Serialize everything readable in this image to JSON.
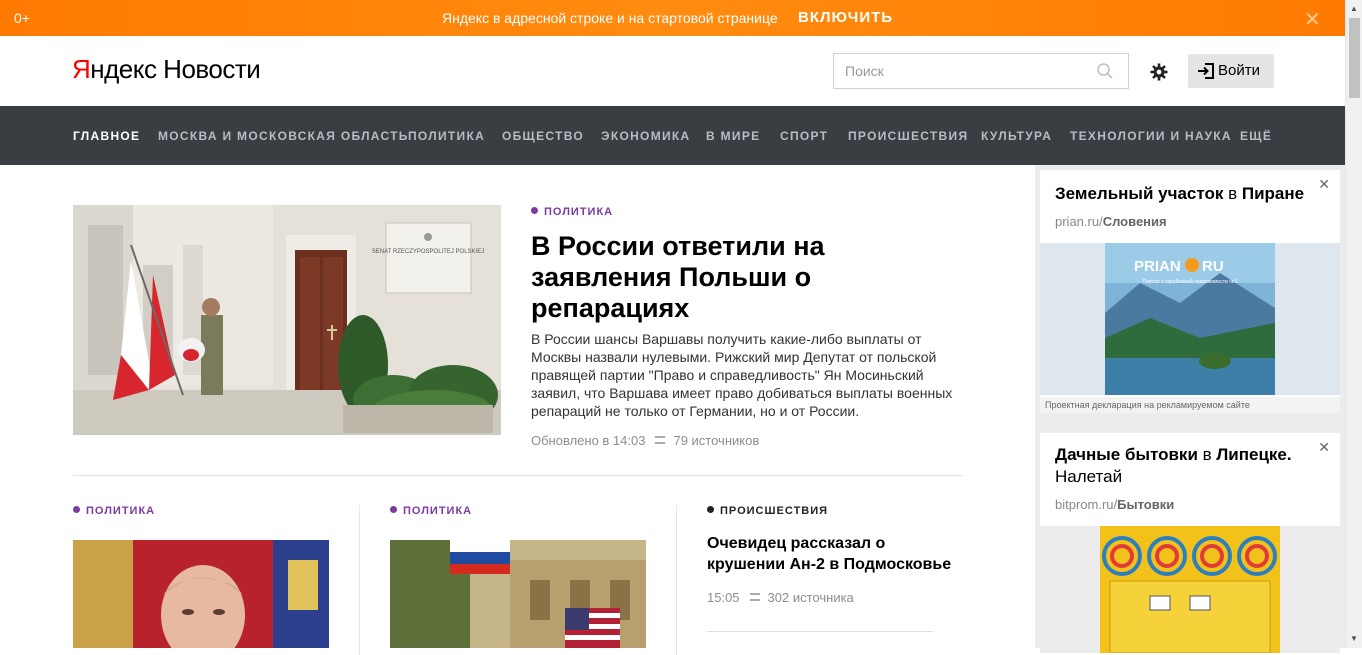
{
  "promo": {
    "age": "0+",
    "message": "Яндекс в адресной строке и на стартовой странице",
    "cta": "ВКЛЮЧИТЬ",
    "close": "✕"
  },
  "header": {
    "logo_brand_first": "Я",
    "logo_brand_rest": "ндекс",
    "logo_service": "Новости",
    "search_placeholder": "Поиск",
    "login_label": "Войти"
  },
  "nav": {
    "items": [
      {
        "label": "ГЛАВНОЕ",
        "active": true
      },
      {
        "label": "МОСКВА И МОСКОВСКАЯ ОБЛАСТЬ"
      },
      {
        "label": "ПОЛИТИКА"
      },
      {
        "label": "ОБЩЕСТВО"
      },
      {
        "label": "ЭКОНОМИКА"
      },
      {
        "label": "В МИРЕ"
      },
      {
        "label": "СПОРТ"
      },
      {
        "label": "ПРОИСШЕСТВИЯ"
      },
      {
        "label": "КУЛЬТУРА"
      },
      {
        "label": "ТЕХНОЛОГИИ И НАУКА"
      },
      {
        "label": "ЕЩЁ"
      }
    ]
  },
  "lead": {
    "rubric": "ПОЛИТИКА",
    "title": "В России ответили на заявления Польши о репарациях",
    "text": "В России шансы Варшавы получить какие-либо выплаты от Москвы назвали нулевыми. Рижский мир Депутат от польской правящей партии \"Право и справедливость\" Ян Мосиньский заявил, что Варшава имеет право добиваться выплаты военных репараций не только от Германии, но и от России.",
    "updated": "Обновлено в 14:03",
    "sources": "79 источников",
    "plaque": "SENAT RZECZYPOSPOLITEJ POLSKIEJ"
  },
  "cards": [
    {
      "rubric": "ПОЛИТИКА"
    },
    {
      "rubric": "ПОЛИТИКА"
    },
    {
      "rubric": "ПРОИСШЕСТВИЯ",
      "title": "Очевидец рассказал о крушении Ан-2 в Подмосковье",
      "time": "15:05",
      "sources": "302 источника"
    }
  ],
  "ads": [
    {
      "title_a": "Земельный участок",
      "title_b": " в ",
      "title_c": "Пиране",
      "domain": "prian.ru/",
      "domain_bold": "Словения",
      "banner_logo": "PRIAN",
      "banner_logo_tail": "RU",
      "banner_tagline": "Портал о зарубежной недвижимости №1",
      "disclaimer": "Проектная декларация на рекламируемом сайте"
    },
    {
      "title_a": "Дачные бытовки",
      "title_b": " в ",
      "title_c": "Липецке.",
      "title_d": "Налетай",
      "domain": "bitprom.ru/",
      "domain_bold": "Бытовки"
    }
  ],
  "colors": {
    "promo_bg": "#ff7a00",
    "nav_bg": "#3a3d42",
    "rubric_politics": "#7c3ba0",
    "logo_red": "#ff0000"
  }
}
